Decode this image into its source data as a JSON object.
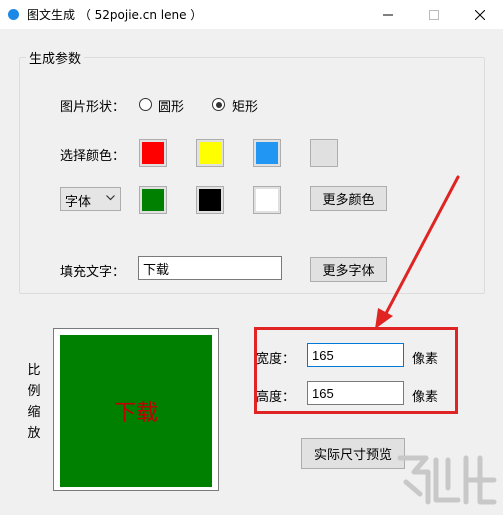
{
  "window": {
    "title": "图文生成 （ 52pojie.cn lene ）",
    "buttons": [
      "minimize",
      "maximize",
      "close"
    ]
  },
  "settings_group": {
    "title": "生成参数",
    "shape": {
      "label": "图片形状：",
      "options": [
        {
          "label": "圆形",
          "checked": false
        },
        {
          "label": "矩形",
          "checked": true
        }
      ]
    },
    "color": {
      "label": "选择颜色：",
      "row1": [
        "#ff0000",
        "#ffff00",
        "#2196f3",
        "#e0e0e0"
      ],
      "row2": [
        "#008000",
        "#000000",
        "#ffffff"
      ],
      "more_colors_button": "更多颜色"
    },
    "font": {
      "select_value": "字体",
      "more_fonts_button": "更多字体"
    },
    "fill_text": {
      "label": "填充文字：",
      "value": "下载"
    }
  },
  "preview": {
    "side_label": [
      "比",
      "例",
      "缩",
      "放"
    ],
    "text": "下载",
    "square_color": "#008000",
    "text_color": "#c00000"
  },
  "size": {
    "width_label": "宽度：",
    "width_value": "165",
    "height_label": "高度：",
    "height_value": "165",
    "unit": "像素"
  },
  "actual_preview_button": "实际尺寸预览",
  "annotation": {
    "color": "#e02424"
  }
}
